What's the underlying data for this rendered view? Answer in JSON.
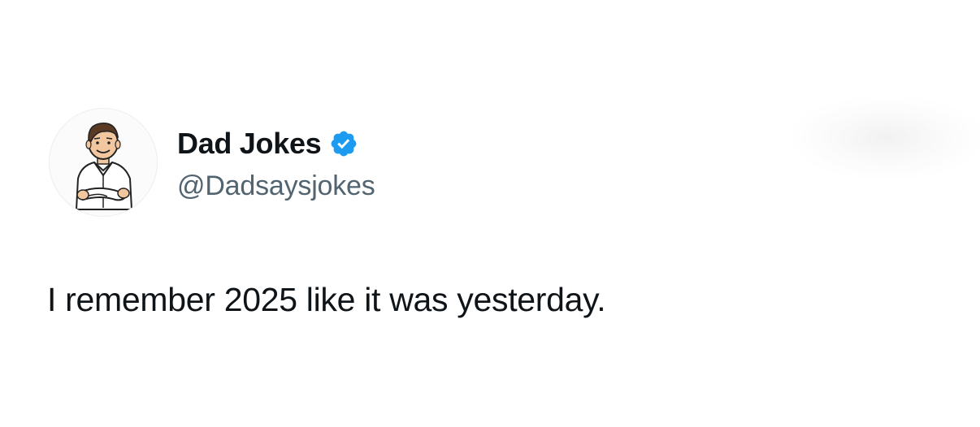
{
  "author": {
    "display_name": "Dad Jokes",
    "handle": "@Dadsaysjokes",
    "verified": true,
    "avatar_icon": "cartoon-dad-avatar-icon",
    "badge_icon": "verified-badge-icon",
    "badge_color": "#1d9bf0"
  },
  "tweet": {
    "text": "I remember 2025 like it was yesterday."
  },
  "colors": {
    "name": "#0f1419",
    "handle": "#536471",
    "body": "#0f1419",
    "background": "#ffffff"
  }
}
